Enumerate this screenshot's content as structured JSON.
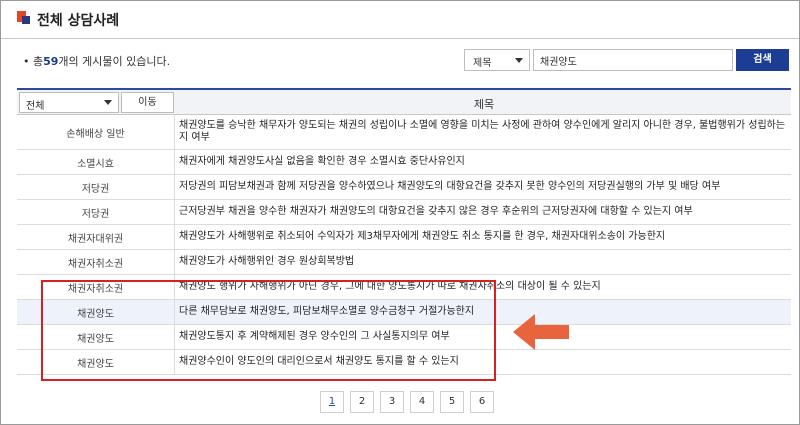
{
  "header": {
    "title": "전체 상담사례"
  },
  "summary": {
    "prefix": "• 총 ",
    "count": "59",
    "suffix": " 개의 게시물이 있습니다."
  },
  "search": {
    "field_selected": "제목",
    "query": "채권양도",
    "button_label": "검색"
  },
  "table": {
    "category_filter": "전체",
    "move_button": "이동",
    "title_header": "제목",
    "rows": [
      {
        "category": "손해배상 일반",
        "title": "채권양도를 승낙한 채무자가 양도되는 채권의 성립이나 소멸에 영향을 미치는 사정에 관하여 양수인에게 알리지 아니한 경우, 불법행위가 성립하는지 여부"
      },
      {
        "category": "소멸시효",
        "title": "채권자에게 채권양도사실 없음을 확인한 경우 소멸시효 중단사유인지"
      },
      {
        "category": "저당권",
        "title": "저당권의 피담보채권과 함께 저당권을 양수하였으나 채권양도의 대항요건을 갖추지 못한 양수인의 저당권실행의 가부 및 배당 여부"
      },
      {
        "category": "저당권",
        "title": "근저당권부 채권을 양수한 채권자가 채권양도의 대항요건을 갖추지 않은 경우 후순위의 근저당권자에 대항할 수 있는지 여부"
      },
      {
        "category": "채권자대위권",
        "title": "채권양도가 사해행위로 취소되어 수익자가 제3채무자에게 채권양도 취소 통지를 한 경우, 채권자대위소송이 가능한지"
      },
      {
        "category": "채권자취소권",
        "title": "채권양도가 사해행위인 경우 원상회복방법"
      },
      {
        "category": "채권자취소권",
        "title": "채권양도 행위가 사해행위가 아닌 경우, 그에 대한 양도통지가 따로 채권자취소의 대상이 될 수 있는지"
      },
      {
        "category": "채권양도",
        "title": "다른 채무담보로 채권양도, 피담보채무소멸로 양수금청구 거절가능한지"
      },
      {
        "category": "채권양도",
        "title": "채권양도통지 후 계약해제된 경우 양수인의 그 사실통지의무 여부"
      },
      {
        "category": "채권양도",
        "title": "채권양수인이 양도인의 대리인으로서 채권양도 통지를 할 수 있는지"
      }
    ]
  },
  "pagination": {
    "pages": [
      "1",
      "2",
      "3",
      "4",
      "5",
      "6"
    ],
    "current": "1"
  },
  "colors": {
    "accent": "#1c3d93",
    "highlight_box": "#d42222",
    "arrow": "#e8643c"
  },
  "icons": {
    "arrow": "left-arrow-icon"
  }
}
